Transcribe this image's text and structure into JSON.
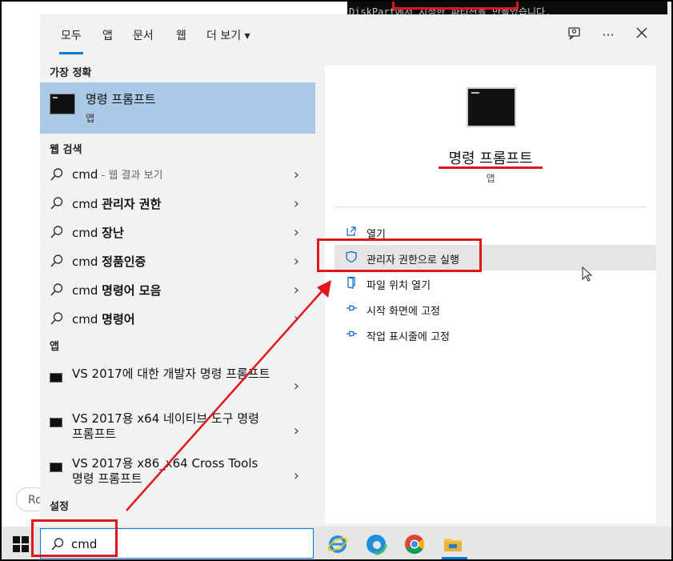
{
  "background": {
    "console_text": "DiskPart에서 지정한 파티션을 만들었습니다.",
    "chip_text": "Ro"
  },
  "tabs": [
    {
      "label": "모두",
      "active": true
    },
    {
      "label": "앱"
    },
    {
      "label": "문서"
    },
    {
      "label": "웹"
    },
    {
      "label": "더 보기 ▾"
    }
  ],
  "header_icons": [
    "feedback-icon",
    "more-options-icon",
    "close-icon"
  ],
  "left": {
    "best_match_heading": "가장 정확",
    "best_match": {
      "title": "명령 프롬프트",
      "subtitle": "앱"
    },
    "web_heading": "웹 검색",
    "web_results": [
      {
        "prefix": "cmd",
        "bold": "",
        "dim": " - 웹 결과 보기"
      },
      {
        "prefix": "cmd ",
        "bold": "관리자 권한",
        "dim": ""
      },
      {
        "prefix": "cmd ",
        "bold": "장난",
        "dim": ""
      },
      {
        "prefix": "cmd ",
        "bold": "정품인증",
        "dim": ""
      },
      {
        "prefix": "cmd ",
        "bold": "명령어 모음",
        "dim": ""
      },
      {
        "prefix": "cmd ",
        "bold": "명령어",
        "dim": ""
      }
    ],
    "apps_heading": "앱",
    "apps": [
      "VS 2017에 대한 개발자 명령 프롬프트",
      "VS 2017용 x64 네이티브 도구 명령 프롬프트",
      "VS 2017용 x86_x64 Cross Tools 명령 프롬프트"
    ],
    "settings_heading": "설정"
  },
  "right": {
    "title": "명령 프롬프트",
    "subtitle": "앱",
    "actions": [
      {
        "label": "열기",
        "icon": "open-icon"
      },
      {
        "label": "관리자 권한으로 실행",
        "icon": "shield-icon",
        "highlighted": true
      },
      {
        "label": "파일 위치 열기",
        "icon": "folder-icon"
      },
      {
        "label": "시작 화면에 고정",
        "icon": "pin-icon"
      },
      {
        "label": "작업 표시줄에 고정",
        "icon": "pin-icon"
      }
    ]
  },
  "taskbar": {
    "search_value": "cmd",
    "apps": [
      "internet-explorer-icon",
      "edge-icon",
      "chrome-icon",
      "file-explorer-icon"
    ]
  },
  "colors": {
    "accent": "#0078d4",
    "annotation_red": "#e0161b",
    "selected_bg": "#a9c9e6"
  }
}
